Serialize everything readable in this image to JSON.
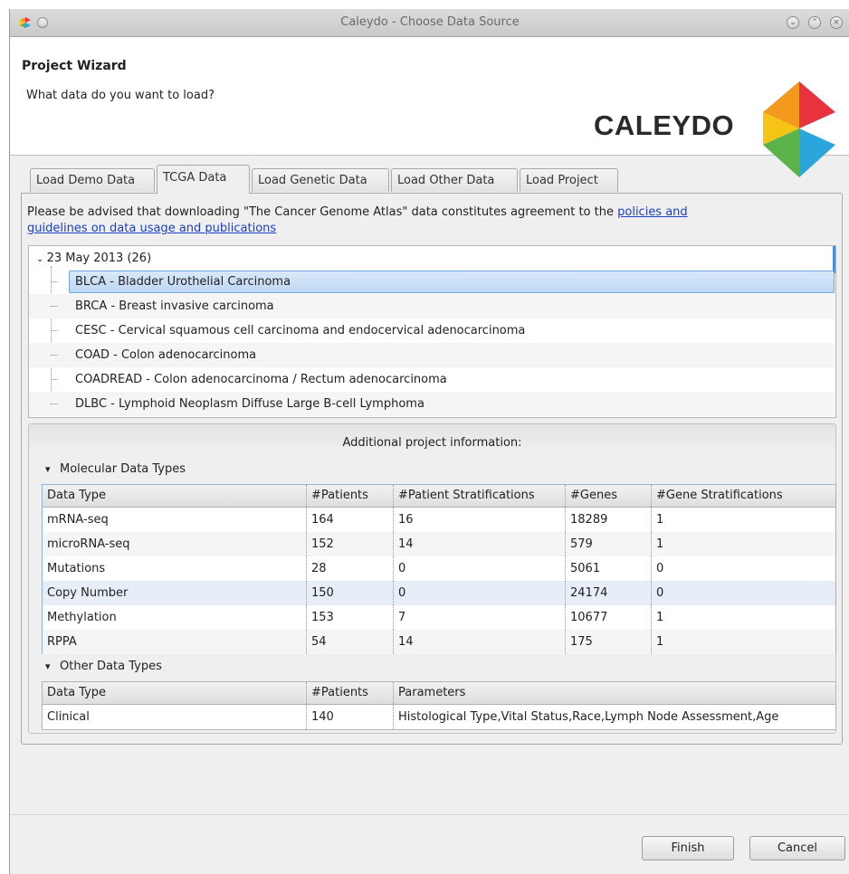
{
  "window": {
    "title": "Caleydo - Choose Data Source"
  },
  "header": {
    "title": "Project Wizard",
    "subtitle": "What data do you want to load?",
    "logo_text": "CALEYDO"
  },
  "tabs": [
    {
      "label": "Load Demo Data"
    },
    {
      "label": "TCGA Data"
    },
    {
      "label": "Load Genetic Data"
    },
    {
      "label": "Load Other Data"
    },
    {
      "label": "Load Project"
    }
  ],
  "advice": {
    "text": "Please be advised that downloading \"The Cancer Genome Atlas\" data constitutes agreement to the ",
    "link1": "policies and",
    "link2": "guidelines on data usage and publications"
  },
  "tree": {
    "root_label": "23 May 2013 (26)",
    "items": [
      {
        "label": "BLCA - Bladder Urothelial Carcinoma"
      },
      {
        "label": "BRCA - Breast invasive carcinoma"
      },
      {
        "label": "CESC - Cervical squamous cell carcinoma and endocervical adenocarcinoma"
      },
      {
        "label": "COAD - Colon adenocarcinoma"
      },
      {
        "label": "COADREAD - Colon adenocarcinoma / Rectum adenocarcinoma"
      },
      {
        "label": "DLBC - Lymphoid Neoplasm Diffuse Large B-cell Lymphoma"
      }
    ]
  },
  "info": {
    "title": "Additional project information:",
    "molecular": {
      "heading": "Molecular Data Types",
      "columns": [
        "Data Type",
        "#Patients",
        "#Patient Stratifications",
        "#Genes",
        "#Gene Stratifications"
      ],
      "rows": [
        [
          "mRNA-seq",
          "164",
          "16",
          "18289",
          "1"
        ],
        [
          "microRNA-seq",
          "152",
          "14",
          "579",
          "1"
        ],
        [
          "Mutations",
          "28",
          "0",
          "5061",
          "0"
        ],
        [
          "Copy Number",
          "150",
          "0",
          "24174",
          "0"
        ],
        [
          "Methylation",
          "153",
          "7",
          "10677",
          "1"
        ],
        [
          "RPPA",
          "54",
          "14",
          "175",
          "1"
        ]
      ]
    },
    "other": {
      "heading": "Other Data Types",
      "columns": [
        "Data Type",
        "#Patients",
        "Parameters"
      ],
      "rows": [
        [
          "Clinical",
          "140",
          "Histological Type,Vital Status,Race,Lymph Node Assessment,Age"
        ]
      ]
    }
  },
  "buttons": {
    "finish": "Finish",
    "cancel": "Cancel"
  },
  "colors": {
    "selection": "#bfd8f3",
    "link": "#1a3fc4",
    "logo_red": "#e8333f",
    "logo_orange": "#f39a1e",
    "logo_yellow": "#f6c415",
    "logo_green": "#5bb34a",
    "logo_blue": "#2aa6dd"
  }
}
